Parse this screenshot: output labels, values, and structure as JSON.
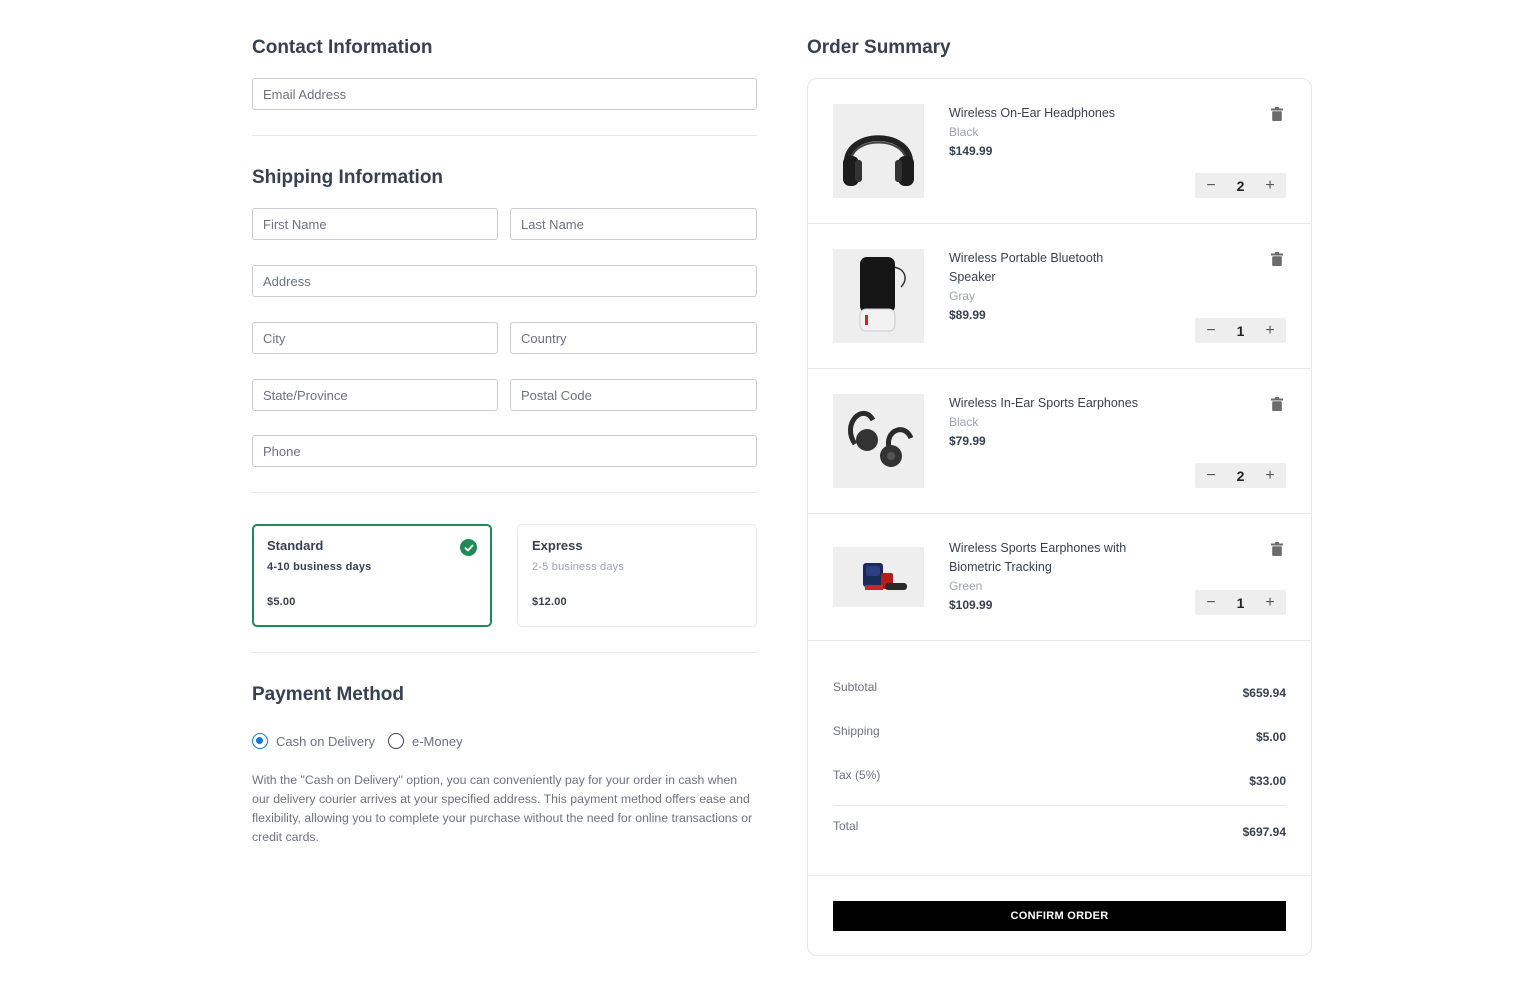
{
  "contact": {
    "heading": "Contact Information",
    "email_placeholder": "Email Address"
  },
  "shipping": {
    "heading": "Shipping Information",
    "first_name_placeholder": "First Name",
    "last_name_placeholder": "Last Name",
    "address_placeholder": "Address",
    "city_placeholder": "City",
    "country_placeholder": "Country",
    "state_placeholder": "State/Province",
    "postal_placeholder": "Postal Code",
    "phone_placeholder": "Phone"
  },
  "delivery_options": [
    {
      "name": "Standard",
      "days": "4-10 business days",
      "price": "$5.00",
      "selected": true
    },
    {
      "name": "Express",
      "days": "2-5 business days",
      "price": "$12.00",
      "selected": false
    }
  ],
  "payment": {
    "heading": "Payment Method",
    "options": [
      {
        "label": "Cash on Delivery",
        "selected": true
      },
      {
        "label": "e-Money",
        "selected": false
      }
    ],
    "description": "With the \"Cash on Delivery\" option, you can conveniently pay for your order in cash when our delivery courier arrives at your specified address. This payment method offers ease and flexibility, allowing you to complete your purchase without the need for online transactions or credit cards."
  },
  "summary": {
    "heading": "Order Summary",
    "items": [
      {
        "title": "Wireless On-Ear Headphones",
        "variant": "Black",
        "price": "$149.99",
        "qty": "2"
      },
      {
        "title": "Wireless Portable Bluetooth Speaker",
        "variant": "Gray",
        "price": "$89.99",
        "qty": "1"
      },
      {
        "title": "Wireless In-Ear Sports Earphones",
        "variant": "Black",
        "price": "$79.99",
        "qty": "2"
      },
      {
        "title": "Wireless Sports Earphones with Biometric Tracking",
        "variant": "Green",
        "price": "$109.99",
        "qty": "1"
      }
    ],
    "subtotal_label": "Subtotal",
    "subtotal_value": "$659.94",
    "shipping_label": "Shipping",
    "shipping_value": "$5.00",
    "tax_label": "Tax (5%)",
    "tax_value": "$33.00",
    "total_label": "Total",
    "total_value": "$697.94",
    "confirm_label": "CONFIRM ORDER"
  },
  "colors": {
    "accent_green": "#1f8a57",
    "radio_blue": "#1976d2",
    "button_black": "#000000"
  }
}
